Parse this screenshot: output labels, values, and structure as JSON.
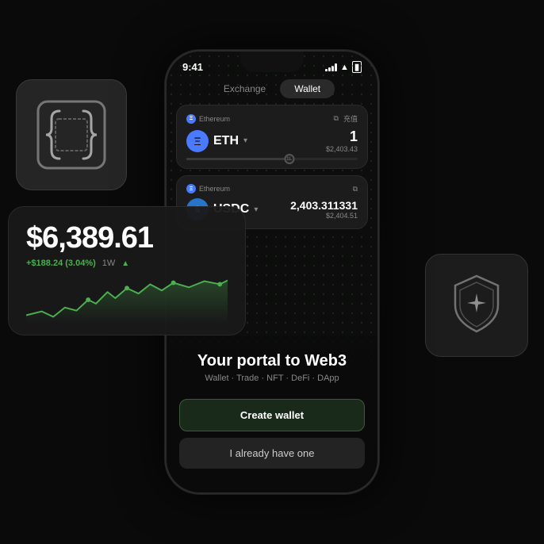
{
  "statusBar": {
    "time": "9:41"
  },
  "tabs": {
    "exchange": "Exchange",
    "wallet": "Wallet"
  },
  "eth": {
    "network": "Ethereum",
    "symbol": "ETH",
    "amount": "1",
    "usd": "$2,403.43",
    "icon": "Ξ"
  },
  "usdc": {
    "network": "Ethereum",
    "symbol": "USDC",
    "amount": "2,403.311331",
    "usd": "$2,404.51",
    "icon": "$"
  },
  "price": {
    "value": "$6,389.61",
    "change": "+$188.24 (3.04%)",
    "period": "1W",
    "direction": "▲"
  },
  "portal": {
    "title": "Your portal to Web3",
    "subtitle": "Wallet · Trade · NFT · DeFi · DApp"
  },
  "buttons": {
    "create": "Create wallet",
    "existing": "I already have one"
  }
}
